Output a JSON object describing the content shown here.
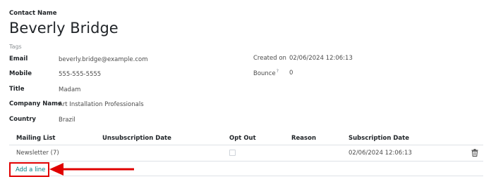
{
  "header": {
    "contact_label": "Contact Name",
    "contact_name": "Beverly Bridge",
    "tags_placeholder": "Tags"
  },
  "fields": {
    "email_label": "Email",
    "email_value": "beverly.bridge@example.com",
    "mobile_label": "Mobile",
    "mobile_value": "555-555-5555",
    "title_label": "Title",
    "title_value": "Madam",
    "company_label": "Company Name",
    "company_value": "Art Installation Professionals",
    "country_label": "Country",
    "country_value": "Brazil",
    "created_label": "Created on",
    "created_value": "02/06/2024 12:06:13",
    "bounce_label": "Bounce",
    "bounce_help": "?",
    "bounce_value": "0"
  },
  "table": {
    "headers": {
      "mailing_list": "Mailing List",
      "unsubscription_date": "Unsubscription Date",
      "opt_out": "Opt Out",
      "reason": "Reason",
      "subscription_date": "Subscription Date"
    },
    "rows": [
      {
        "mailing_list": "Newsletter (7)",
        "unsubscription_date": "",
        "opt_out": false,
        "reason": "",
        "subscription_date": "02/06/2024 12:06:13"
      }
    ],
    "add_line_label": "Add a line"
  },
  "annotation": {
    "highlight_color": "#e00000"
  },
  "colors": {
    "link": "#017e84",
    "text": "#212529",
    "muted": "#8a8f93",
    "border": "#dee2e6"
  }
}
